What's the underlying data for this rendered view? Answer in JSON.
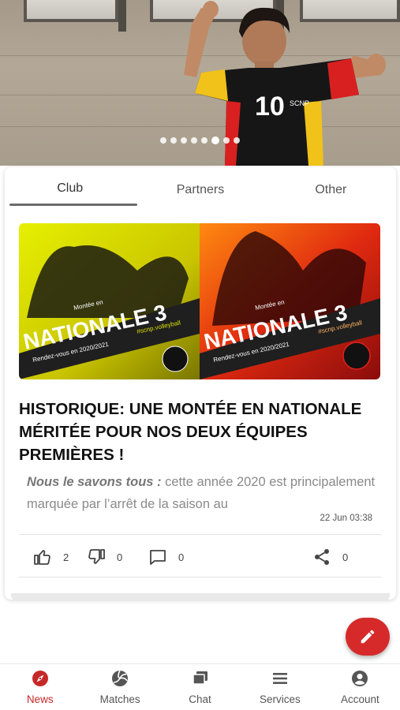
{
  "hero": {
    "slide_count": 8,
    "active_slide": 6,
    "jersey_number": "10"
  },
  "tabs": [
    {
      "label": "Club",
      "active": true
    },
    {
      "label": "Partners",
      "active": false
    },
    {
      "label": "Other",
      "active": false
    }
  ],
  "post": {
    "banner": {
      "left": {
        "line1": "Montée en",
        "line2": "NATIONALE 3",
        "tagline": "Rendez-vous en 2020/2021",
        "hashtag": "#scnp.volleyball"
      },
      "right": {
        "line1": "Montée en",
        "line2": "NATIONALE 3",
        "tagline": "Rendez-vous en 2020/2021",
        "hashtag": "#scnp.volleyball"
      }
    },
    "title": "HISTORIQUE: UNE MONTÉE EN NATIONALE MÉRITÉE POUR NOS DEUX ÉQUIPES PREMIÈRES !",
    "excerpt_bold": "Nous le savons tous :",
    "excerpt_text": " cette année 2020 est principalement marquée par l’arrêt de la saison au",
    "date": "22 Jun 03:38",
    "likes": "2",
    "dislikes": "0",
    "comments": "0",
    "shares": "0"
  },
  "nav": [
    {
      "label": "News",
      "icon": "compass-icon",
      "active": true
    },
    {
      "label": "Matches",
      "icon": "volleyball-icon",
      "active": false
    },
    {
      "label": "Chat",
      "icon": "chat-icon",
      "active": false
    },
    {
      "label": "Services",
      "icon": "menu-icon",
      "active": false
    },
    {
      "label": "Account",
      "icon": "account-icon",
      "active": false
    }
  ],
  "colors": {
    "accent": "#c62828",
    "fab": "#d62a2a"
  }
}
